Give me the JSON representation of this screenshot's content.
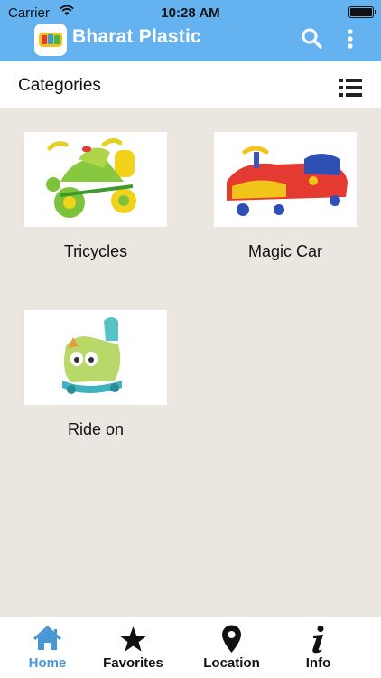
{
  "status_bar": {
    "carrier": "Carrier",
    "time": "10:28 AM"
  },
  "app_bar": {
    "title": "Bharat Plastic",
    "accent_color": "#65b2f0"
  },
  "subheader": {
    "title": "Categories"
  },
  "categories": [
    {
      "label": "Tricycles"
    },
    {
      "label": "Magic Car"
    },
    {
      "label": "Ride on"
    }
  ],
  "tabs": [
    {
      "label": "Home",
      "icon": "home-icon",
      "active": true
    },
    {
      "label": "Favorites",
      "icon": "star-icon",
      "active": false
    },
    {
      "label": "Location",
      "icon": "location-pin-icon",
      "active": false
    },
    {
      "label": "Info",
      "icon": "info-icon",
      "active": false
    }
  ]
}
